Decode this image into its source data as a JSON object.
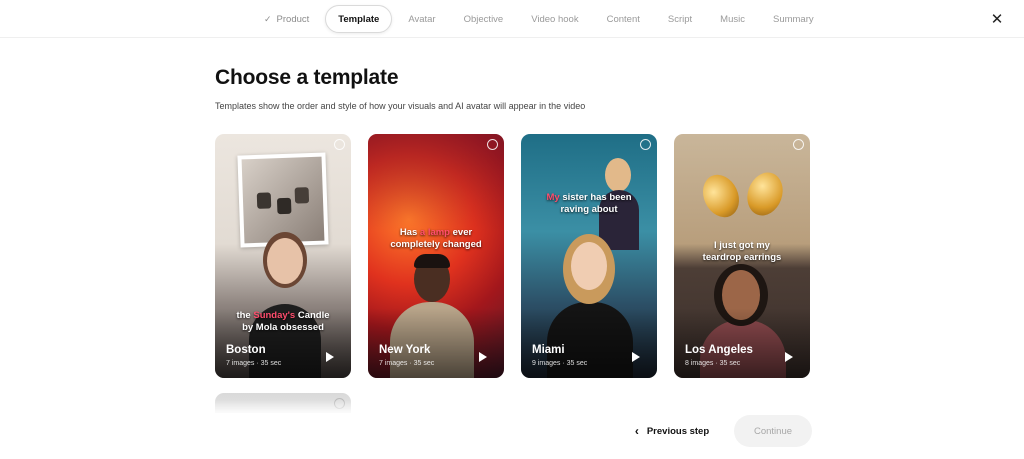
{
  "steps": [
    {
      "label": "Product",
      "state": "done"
    },
    {
      "label": "Template",
      "state": "active"
    },
    {
      "label": "Avatar",
      "state": "pending"
    },
    {
      "label": "Objective",
      "state": "pending"
    },
    {
      "label": "Video hook",
      "state": "pending"
    },
    {
      "label": "Content",
      "state": "pending"
    },
    {
      "label": "Script",
      "state": "pending"
    },
    {
      "label": "Music",
      "state": "pending"
    },
    {
      "label": "Summary",
      "state": "pending"
    }
  ],
  "close_icon": "close-icon",
  "page": {
    "title": "Choose a template",
    "subtitle": "Templates show the order and style of how your visuals and AI avatar will appear in the video"
  },
  "templates": [
    {
      "city": "Boston",
      "meta": "7 images · 35 sec",
      "caption_pre": "the ",
      "caption_hl": "Sunday's",
      "caption_post": " Candle",
      "caption_line2": "by Mola obsessed"
    },
    {
      "city": "New York",
      "meta": "7 images · 35 sec",
      "caption_pre": "Has ",
      "caption_hl": "a lamp",
      "caption_post": " ever",
      "caption_line2": "completely changed"
    },
    {
      "city": "Miami",
      "meta": "9 images · 35 sec",
      "caption_pre": "",
      "caption_hl": "My",
      "caption_post": " sister has been",
      "caption_line2": "raving about"
    },
    {
      "city": "Los Angeles",
      "meta": "8 images · 35 sec",
      "caption_pre": "I just got my",
      "caption_hl": "",
      "caption_post": "",
      "caption_line2": "teardrop earrings"
    }
  ],
  "footer": {
    "previous_label": "Previous step",
    "continue_label": "Continue"
  },
  "colors": {
    "caption_highlight": "#ff4d6d",
    "active_step_border": "#dadada",
    "continue_disabled_bg": "#f2f2f2"
  }
}
